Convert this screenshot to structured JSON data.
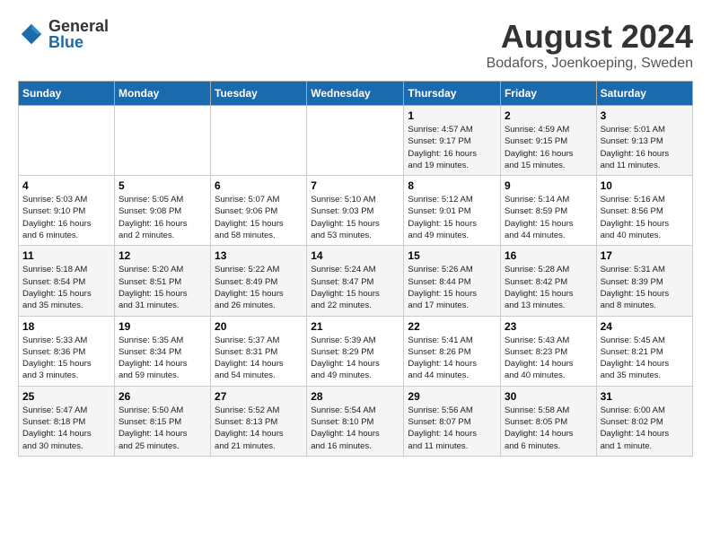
{
  "header": {
    "logo": {
      "general": "General",
      "blue": "Blue"
    },
    "title": "August 2024",
    "location": "Bodafors, Joenkoeping, Sweden"
  },
  "days_of_week": [
    "Sunday",
    "Monday",
    "Tuesday",
    "Wednesday",
    "Thursday",
    "Friday",
    "Saturday"
  ],
  "weeks": [
    [
      {
        "day": "",
        "info": ""
      },
      {
        "day": "",
        "info": ""
      },
      {
        "day": "",
        "info": ""
      },
      {
        "day": "",
        "info": ""
      },
      {
        "day": "1",
        "info": "Sunrise: 4:57 AM\nSunset: 9:17 PM\nDaylight: 16 hours\nand 19 minutes."
      },
      {
        "day": "2",
        "info": "Sunrise: 4:59 AM\nSunset: 9:15 PM\nDaylight: 16 hours\nand 15 minutes."
      },
      {
        "day": "3",
        "info": "Sunrise: 5:01 AM\nSunset: 9:13 PM\nDaylight: 16 hours\nand 11 minutes."
      }
    ],
    [
      {
        "day": "4",
        "info": "Sunrise: 5:03 AM\nSunset: 9:10 PM\nDaylight: 16 hours\nand 6 minutes."
      },
      {
        "day": "5",
        "info": "Sunrise: 5:05 AM\nSunset: 9:08 PM\nDaylight: 16 hours\nand 2 minutes."
      },
      {
        "day": "6",
        "info": "Sunrise: 5:07 AM\nSunset: 9:06 PM\nDaylight: 15 hours\nand 58 minutes."
      },
      {
        "day": "7",
        "info": "Sunrise: 5:10 AM\nSunset: 9:03 PM\nDaylight: 15 hours\nand 53 minutes."
      },
      {
        "day": "8",
        "info": "Sunrise: 5:12 AM\nSunset: 9:01 PM\nDaylight: 15 hours\nand 49 minutes."
      },
      {
        "day": "9",
        "info": "Sunrise: 5:14 AM\nSunset: 8:59 PM\nDaylight: 15 hours\nand 44 minutes."
      },
      {
        "day": "10",
        "info": "Sunrise: 5:16 AM\nSunset: 8:56 PM\nDaylight: 15 hours\nand 40 minutes."
      }
    ],
    [
      {
        "day": "11",
        "info": "Sunrise: 5:18 AM\nSunset: 8:54 PM\nDaylight: 15 hours\nand 35 minutes."
      },
      {
        "day": "12",
        "info": "Sunrise: 5:20 AM\nSunset: 8:51 PM\nDaylight: 15 hours\nand 31 minutes."
      },
      {
        "day": "13",
        "info": "Sunrise: 5:22 AM\nSunset: 8:49 PM\nDaylight: 15 hours\nand 26 minutes."
      },
      {
        "day": "14",
        "info": "Sunrise: 5:24 AM\nSunset: 8:47 PM\nDaylight: 15 hours\nand 22 minutes."
      },
      {
        "day": "15",
        "info": "Sunrise: 5:26 AM\nSunset: 8:44 PM\nDaylight: 15 hours\nand 17 minutes."
      },
      {
        "day": "16",
        "info": "Sunrise: 5:28 AM\nSunset: 8:42 PM\nDaylight: 15 hours\nand 13 minutes."
      },
      {
        "day": "17",
        "info": "Sunrise: 5:31 AM\nSunset: 8:39 PM\nDaylight: 15 hours\nand 8 minutes."
      }
    ],
    [
      {
        "day": "18",
        "info": "Sunrise: 5:33 AM\nSunset: 8:36 PM\nDaylight: 15 hours\nand 3 minutes."
      },
      {
        "day": "19",
        "info": "Sunrise: 5:35 AM\nSunset: 8:34 PM\nDaylight: 14 hours\nand 59 minutes."
      },
      {
        "day": "20",
        "info": "Sunrise: 5:37 AM\nSunset: 8:31 PM\nDaylight: 14 hours\nand 54 minutes."
      },
      {
        "day": "21",
        "info": "Sunrise: 5:39 AM\nSunset: 8:29 PM\nDaylight: 14 hours\nand 49 minutes."
      },
      {
        "day": "22",
        "info": "Sunrise: 5:41 AM\nSunset: 8:26 PM\nDaylight: 14 hours\nand 44 minutes."
      },
      {
        "day": "23",
        "info": "Sunrise: 5:43 AM\nSunset: 8:23 PM\nDaylight: 14 hours\nand 40 minutes."
      },
      {
        "day": "24",
        "info": "Sunrise: 5:45 AM\nSunset: 8:21 PM\nDaylight: 14 hours\nand 35 minutes."
      }
    ],
    [
      {
        "day": "25",
        "info": "Sunrise: 5:47 AM\nSunset: 8:18 PM\nDaylight: 14 hours\nand 30 minutes."
      },
      {
        "day": "26",
        "info": "Sunrise: 5:50 AM\nSunset: 8:15 PM\nDaylight: 14 hours\nand 25 minutes."
      },
      {
        "day": "27",
        "info": "Sunrise: 5:52 AM\nSunset: 8:13 PM\nDaylight: 14 hours\nand 21 minutes."
      },
      {
        "day": "28",
        "info": "Sunrise: 5:54 AM\nSunset: 8:10 PM\nDaylight: 14 hours\nand 16 minutes."
      },
      {
        "day": "29",
        "info": "Sunrise: 5:56 AM\nSunset: 8:07 PM\nDaylight: 14 hours\nand 11 minutes."
      },
      {
        "day": "30",
        "info": "Sunrise: 5:58 AM\nSunset: 8:05 PM\nDaylight: 14 hours\nand 6 minutes."
      },
      {
        "day": "31",
        "info": "Sunrise: 6:00 AM\nSunset: 8:02 PM\nDaylight: 14 hours\nand 1 minute."
      }
    ]
  ]
}
